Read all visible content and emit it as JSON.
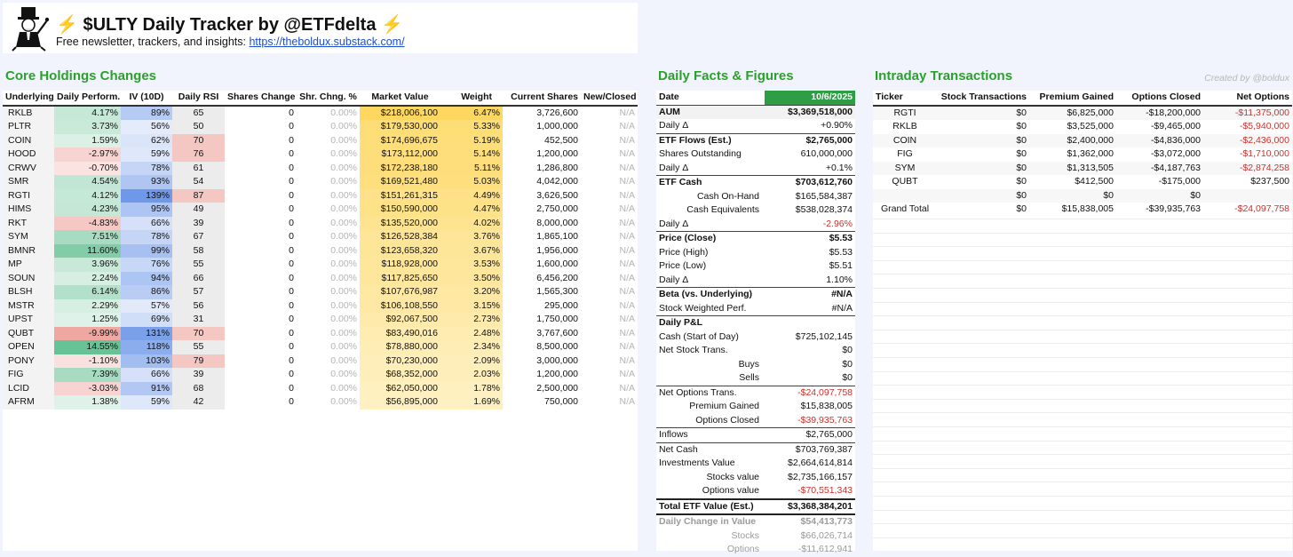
{
  "header": {
    "title_text": "$ULTY Daily Tracker by @ETFdelta",
    "bolt": "⚡",
    "subtitle_prefix": "Free newsletter, trackers, and insights: ",
    "link": "https://theboldux.substack.com/"
  },
  "sections": {
    "core": "Core Holdings Changes",
    "facts": "Daily Facts & Figures",
    "intraday": "Intraday Transactions",
    "credit": "Created by @boldux"
  },
  "core": {
    "columns": [
      "Underlying",
      "Daily Perform.",
      "IV (10D)",
      "Daily RSI",
      "Shares Change",
      "Shr. Chng. %",
      "Market Value",
      "Weight",
      "Current Shares",
      "New/Closed"
    ],
    "rows": [
      {
        "t": "RKLB",
        "p": "4.17%",
        "pv": 4.17,
        "iv": "89%",
        "ivv": 89,
        "rsi": "65",
        "rsiv": 65,
        "sc": "0",
        "scp": "0.00%",
        "mv": "$218,006,100",
        "w": "6.47%",
        "wv": 6.47,
        "cs": "3,726,600",
        "nc": "N/A"
      },
      {
        "t": "PLTR",
        "p": "3.73%",
        "pv": 3.73,
        "iv": "56%",
        "ivv": 56,
        "rsi": "50",
        "rsiv": 50,
        "sc": "0",
        "scp": "0.00%",
        "mv": "$179,530,000",
        "w": "5.33%",
        "wv": 5.33,
        "cs": "1,000,000",
        "nc": "N/A"
      },
      {
        "t": "COIN",
        "p": "1.59%",
        "pv": 1.59,
        "iv": "62%",
        "ivv": 62,
        "rsi": "70",
        "rsiv": 70,
        "sc": "0",
        "scp": "0.00%",
        "mv": "$174,696,675",
        "w": "5.19%",
        "wv": 5.19,
        "cs": "452,500",
        "nc": "N/A"
      },
      {
        "t": "HOOD",
        "p": "-2.97%",
        "pv": -2.97,
        "iv": "59%",
        "ivv": 59,
        "rsi": "76",
        "rsiv": 76,
        "sc": "0",
        "scp": "0.00%",
        "mv": "$173,112,000",
        "w": "5.14%",
        "wv": 5.14,
        "cs": "1,200,000",
        "nc": "N/A"
      },
      {
        "t": "CRWV",
        "p": "-0.70%",
        "pv": -0.7,
        "iv": "78%",
        "ivv": 78,
        "rsi": "61",
        "rsiv": 61,
        "sc": "0",
        "scp": "0.00%",
        "mv": "$172,238,180",
        "w": "5.11%",
        "wv": 5.11,
        "cs": "1,286,800",
        "nc": "N/A"
      },
      {
        "t": "SMR",
        "p": "4.54%",
        "pv": 4.54,
        "iv": "93%",
        "ivv": 93,
        "rsi": "54",
        "rsiv": 54,
        "sc": "0",
        "scp": "0.00%",
        "mv": "$169,521,480",
        "w": "5.03%",
        "wv": 5.03,
        "cs": "4,042,000",
        "nc": "N/A"
      },
      {
        "t": "RGTI",
        "p": "4.12%",
        "pv": 4.12,
        "iv": "139%",
        "ivv": 139,
        "rsi": "87",
        "rsiv": 87,
        "sc": "0",
        "scp": "0.00%",
        "mv": "$151,261,315",
        "w": "4.49%",
        "wv": 4.49,
        "cs": "3,626,500",
        "nc": "N/A"
      },
      {
        "t": "HIMS",
        "p": "4.23%",
        "pv": 4.23,
        "iv": "95%",
        "ivv": 95,
        "rsi": "49",
        "rsiv": 49,
        "sc": "0",
        "scp": "0.00%",
        "mv": "$150,590,000",
        "w": "4.47%",
        "wv": 4.47,
        "cs": "2,750,000",
        "nc": "N/A"
      },
      {
        "t": "RKT",
        "p": "-4.83%",
        "pv": -4.83,
        "iv": "66%",
        "ivv": 66,
        "rsi": "39",
        "rsiv": 39,
        "sc": "0",
        "scp": "0.00%",
        "mv": "$135,520,000",
        "w": "4.02%",
        "wv": 4.02,
        "cs": "8,000,000",
        "nc": "N/A"
      },
      {
        "t": "SYM",
        "p": "7.51%",
        "pv": 7.51,
        "iv": "78%",
        "ivv": 78,
        "rsi": "67",
        "rsiv": 67,
        "sc": "0",
        "scp": "0.00%",
        "mv": "$126,528,384",
        "w": "3.76%",
        "wv": 3.76,
        "cs": "1,865,100",
        "nc": "N/A"
      },
      {
        "t": "BMNR",
        "p": "11.60%",
        "pv": 11.6,
        "iv": "99%",
        "ivv": 99,
        "rsi": "58",
        "rsiv": 58,
        "sc": "0",
        "scp": "0.00%",
        "mv": "$123,658,320",
        "w": "3.67%",
        "wv": 3.67,
        "cs": "1,956,000",
        "nc": "N/A"
      },
      {
        "t": "MP",
        "p": "3.96%",
        "pv": 3.96,
        "iv": "76%",
        "ivv": 76,
        "rsi": "55",
        "rsiv": 55,
        "sc": "0",
        "scp": "0.00%",
        "mv": "$118,928,000",
        "w": "3.53%",
        "wv": 3.53,
        "cs": "1,600,000",
        "nc": "N/A"
      },
      {
        "t": "SOUN",
        "p": "2.24%",
        "pv": 2.24,
        "iv": "94%",
        "ivv": 94,
        "rsi": "66",
        "rsiv": 66,
        "sc": "0",
        "scp": "0.00%",
        "mv": "$117,825,650",
        "w": "3.50%",
        "wv": 3.5,
        "cs": "6,456,200",
        "nc": "N/A"
      },
      {
        "t": "BLSH",
        "p": "6.14%",
        "pv": 6.14,
        "iv": "86%",
        "ivv": 86,
        "rsi": "57",
        "rsiv": 57,
        "sc": "0",
        "scp": "0.00%",
        "mv": "$107,676,987",
        "w": "3.20%",
        "wv": 3.2,
        "cs": "1,565,300",
        "nc": "N/A"
      },
      {
        "t": "MSTR",
        "p": "2.29%",
        "pv": 2.29,
        "iv": "57%",
        "ivv": 57,
        "rsi": "56",
        "rsiv": 56,
        "sc": "0",
        "scp": "0.00%",
        "mv": "$106,108,550",
        "w": "3.15%",
        "wv": 3.15,
        "cs": "295,000",
        "nc": "N/A"
      },
      {
        "t": "UPST",
        "p": "1.25%",
        "pv": 1.25,
        "iv": "69%",
        "ivv": 69,
        "rsi": "31",
        "rsiv": 31,
        "sc": "0",
        "scp": "0.00%",
        "mv": "$92,067,500",
        "w": "2.73%",
        "wv": 2.73,
        "cs": "1,750,000",
        "nc": "N/A"
      },
      {
        "t": "QUBT",
        "p": "-9.99%",
        "pv": -9.99,
        "iv": "131%",
        "ivv": 131,
        "rsi": "70",
        "rsiv": 70,
        "sc": "0",
        "scp": "0.00%",
        "mv": "$83,490,016",
        "w": "2.48%",
        "wv": 2.48,
        "cs": "3,767,600",
        "nc": "N/A"
      },
      {
        "t": "OPEN",
        "p": "14.55%",
        "pv": 14.55,
        "iv": "118%",
        "ivv": 118,
        "rsi": "55",
        "rsiv": 55,
        "sc": "0",
        "scp": "0.00%",
        "mv": "$78,880,000",
        "w": "2.34%",
        "wv": 2.34,
        "cs": "8,500,000",
        "nc": "N/A"
      },
      {
        "t": "PONY",
        "p": "-1.10%",
        "pv": -1.1,
        "iv": "103%",
        "ivv": 103,
        "rsi": "79",
        "rsiv": 79,
        "sc": "0",
        "scp": "0.00%",
        "mv": "$70,230,000",
        "w": "2.09%",
        "wv": 2.09,
        "cs": "3,000,000",
        "nc": "N/A"
      },
      {
        "t": "FIG",
        "p": "7.39%",
        "pv": 7.39,
        "iv": "66%",
        "ivv": 66,
        "rsi": "39",
        "rsiv": 39,
        "sc": "0",
        "scp": "0.00%",
        "mv": "$68,352,000",
        "w": "2.03%",
        "wv": 2.03,
        "cs": "1,200,000",
        "nc": "N/A"
      },
      {
        "t": "LCID",
        "p": "-3.03%",
        "pv": -3.03,
        "iv": "91%",
        "ivv": 91,
        "rsi": "68",
        "rsiv": 68,
        "sc": "0",
        "scp": "0.00%",
        "mv": "$62,050,000",
        "w": "1.78%",
        "wv": 1.78,
        "cs": "2,500,000",
        "nc": "N/A"
      },
      {
        "t": "AFRM",
        "p": "1.38%",
        "pv": 1.38,
        "iv": "59%",
        "ivv": 59,
        "rsi": "42",
        "rsiv": 42,
        "sc": "0",
        "scp": "0.00%",
        "mv": "$56,895,000",
        "w": "1.69%",
        "wv": 1.69,
        "cs": "750,000",
        "nc": "N/A"
      }
    ]
  },
  "facts": {
    "date_label": "Date",
    "date_value": "10/6/2025",
    "rows": [
      {
        "label": "AUM",
        "value": "$3,369,518,000",
        "bold": true,
        "indent": 0,
        "sep": "thin"
      },
      {
        "label": "Daily Δ",
        "value": "+0.90%",
        "bold": false,
        "indent": 0
      },
      {
        "label": "ETF Flows (Est.)",
        "value": "$2,765,000",
        "bold": true,
        "indent": 0,
        "sep": "thin"
      },
      {
        "label": "Shares Outstanding",
        "value": "610,000,000",
        "bold": false,
        "indent": 0
      },
      {
        "label": "Daily Δ",
        "value": "+0.1%",
        "bold": false,
        "indent": 0
      },
      {
        "label": "ETF Cash",
        "value": "$703,612,760",
        "bold": true,
        "indent": 0,
        "sep": "thin"
      },
      {
        "label": "Cash On-Hand",
        "value": "$165,584,387",
        "bold": false,
        "indent": 1
      },
      {
        "label": "Cash Equivalents",
        "value": "$538,028,374",
        "bold": false,
        "indent": 1
      },
      {
        "label": "Daily Δ",
        "value": "-2.96%",
        "bold": false,
        "indent": 0,
        "neg": true
      },
      {
        "label": "Price (Close)",
        "value": "$5.53",
        "bold": true,
        "indent": 0,
        "sep": "thin"
      },
      {
        "label": "Price (High)",
        "value": "$5.53",
        "bold": false,
        "indent": 0
      },
      {
        "label": "Price (Low)",
        "value": "$5.51",
        "bold": false,
        "indent": 0
      },
      {
        "label": "Daily Δ",
        "value": "1.10%",
        "bold": false,
        "indent": 0
      },
      {
        "label": "Beta (vs. Underlying)",
        "value": "#N/A",
        "bold": true,
        "indent": 0,
        "sep": "thin"
      },
      {
        "label": "Stock Weighted Perf.",
        "value": "#N/A",
        "bold": false,
        "indent": 0
      },
      {
        "label": "Daily P&L",
        "value": "",
        "bold": true,
        "indent": 0,
        "sep": "thin"
      },
      {
        "label": "Cash (Start of Day)",
        "value": "$725,102,145",
        "bold": false,
        "indent": 0
      },
      {
        "label": "Net Stock Trans.",
        "value": "$0",
        "bold": false,
        "indent": 0
      },
      {
        "label": "Buys",
        "value": "$0",
        "bold": false,
        "indent": 1
      },
      {
        "label": "Sells",
        "value": "$0",
        "bold": false,
        "indent": 1
      },
      {
        "label": "Net Options Trans.",
        "value": "-$24,097,758",
        "bold": false,
        "indent": 0,
        "neg": true,
        "sep": "thin"
      },
      {
        "label": "Premium Gained",
        "value": "$15,838,005",
        "bold": false,
        "indent": 1
      },
      {
        "label": "Options Closed",
        "value": "-$39,935,763",
        "bold": false,
        "indent": 1,
        "neg": true
      },
      {
        "label": "Inflows",
        "value": "$2,765,000",
        "bold": false,
        "indent": 0,
        "sep": "thin"
      },
      {
        "label": "Net Cash",
        "value": "$703,769,387",
        "bold": false,
        "indent": 0,
        "sep": "thin"
      },
      {
        "label": "Investments Value",
        "value": "$2,664,614,814",
        "bold": false,
        "indent": 0
      },
      {
        "label": "Stocks value",
        "value": "$2,735,166,157",
        "bold": false,
        "indent": 1
      },
      {
        "label": "Options value",
        "value": "-$70,551,343",
        "bold": false,
        "indent": 1,
        "neg": true
      },
      {
        "label": "Total ETF Value (Est.)",
        "value": "$3,368,384,201",
        "bold": true,
        "indent": 0,
        "sep": "thick"
      },
      {
        "label": "Daily Change in Value",
        "value": "$54,413,773",
        "bold": true,
        "indent": 0,
        "grey": true,
        "sep": "thick"
      },
      {
        "label": "Stocks",
        "value": "$66,026,714",
        "bold": false,
        "indent": 1,
        "grey": true
      },
      {
        "label": "Options",
        "value": "-$11,612,941",
        "bold": false,
        "indent": 1,
        "grey": true
      }
    ]
  },
  "intraday": {
    "columns": [
      "Ticker",
      "Stock Transactions",
      "Premium Gained",
      "Options Closed",
      "Net Options"
    ],
    "rows": [
      {
        "t": "RGTI",
        "st": "$0",
        "pg": "$6,825,000",
        "oc": "-$18,200,000",
        "no": "-$11,375,000",
        "neg": true
      },
      {
        "t": "RKLB",
        "st": "$0",
        "pg": "$3,525,000",
        "oc": "-$9,465,000",
        "no": "-$5,940,000",
        "neg": true
      },
      {
        "t": "COIN",
        "st": "$0",
        "pg": "$2,400,000",
        "oc": "-$4,836,000",
        "no": "-$2,436,000",
        "neg": true
      },
      {
        "t": "FIG",
        "st": "$0",
        "pg": "$1,362,000",
        "oc": "-$3,072,000",
        "no": "-$1,710,000",
        "neg": true
      },
      {
        "t": "SYM",
        "st": "$0",
        "pg": "$1,313,505",
        "oc": "-$4,187,763",
        "no": "-$2,874,258",
        "neg": true
      },
      {
        "t": "QUBT",
        "st": "$0",
        "pg": "$412,500",
        "oc": "-$175,000",
        "no": "$237,500",
        "neg": false
      },
      {
        "t": "",
        "st": "$0",
        "pg": "$0",
        "oc": "$0",
        "no": "",
        "neg": false
      },
      {
        "t": "Grand Total",
        "st": "$0",
        "pg": "$15,838,005",
        "oc": "-$39,935,763",
        "no": "-$24,097,758",
        "neg": true
      }
    ]
  },
  "colors": {
    "accent_green": "#2ca02c",
    "date_header_green": "#2e9e44",
    "negative_red": "#d0312d",
    "link_blue": "#1a4fd0",
    "bolt_yellow": "#f2b705"
  }
}
